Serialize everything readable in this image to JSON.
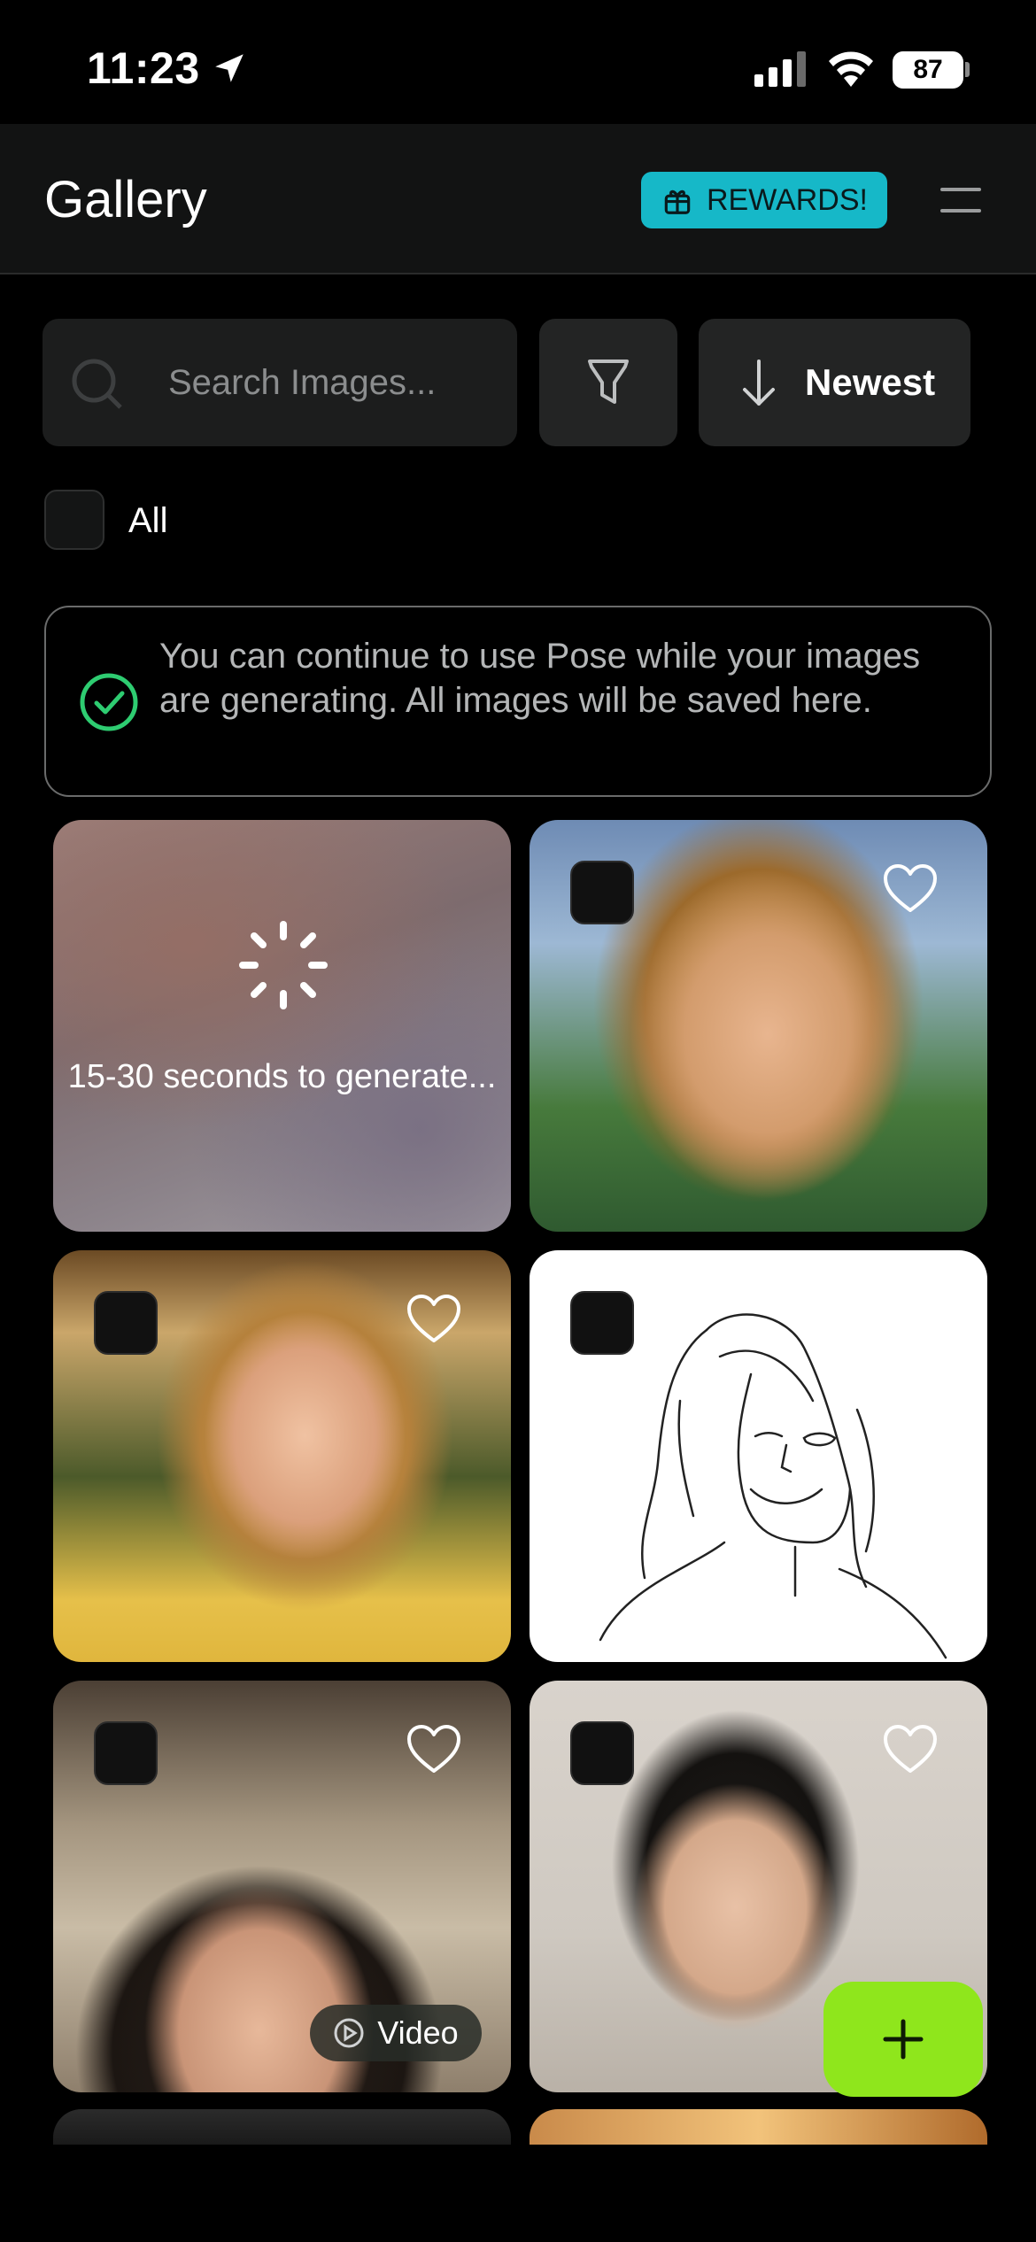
{
  "status_bar": {
    "time": "11:23",
    "battery": "87"
  },
  "header": {
    "title": "Gallery",
    "rewards_label": "REWARDS!",
    "rewards_color": "#16b8c8"
  },
  "controls": {
    "search_placeholder": "Search Images...",
    "sort_label": "Newest",
    "select_all_label": "All"
  },
  "notice": {
    "text": "You can continue to use Pose while your images are generating. All images will be saved here.",
    "icon": "check-circle-icon",
    "icon_color": "#2ecc71"
  },
  "grid": {
    "generating_text": "15-30 seconds to generate...",
    "tiles": [
      {
        "kind": "generating"
      },
      {
        "kind": "image",
        "subject": "woman-stadium-laptop",
        "selectable": true,
        "favorite_icon": "heart-icon"
      },
      {
        "kind": "image",
        "subject": "woman-stadium-jersey",
        "selectable": true,
        "favorite_icon": "heart-icon"
      },
      {
        "kind": "image",
        "subject": "line-sketch",
        "selectable": true
      },
      {
        "kind": "video",
        "subject": "woman-chandelier",
        "selectable": true,
        "favorite_icon": "heart-icon",
        "badge": "Video"
      },
      {
        "kind": "image",
        "subject": "man-portrait",
        "selectable": true,
        "favorite_icon": "heart-icon"
      }
    ]
  },
  "fab": {
    "icon": "plus-icon",
    "color": "#8fe61c"
  }
}
